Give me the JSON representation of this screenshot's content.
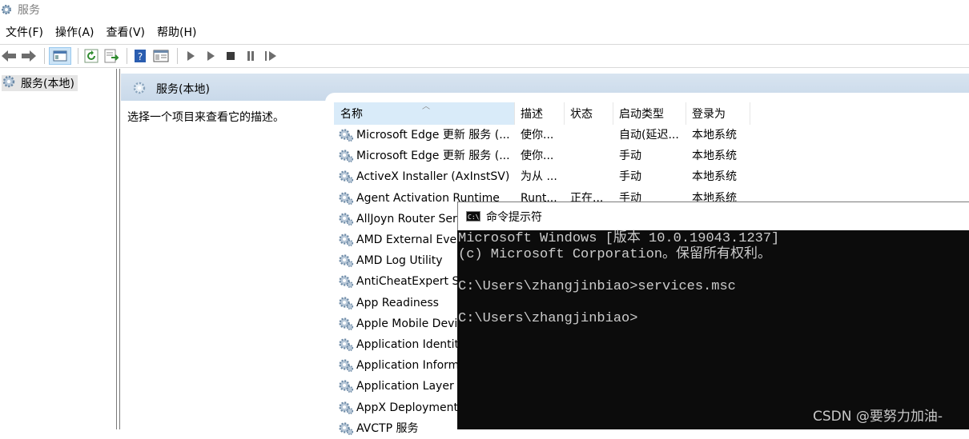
{
  "window": {
    "title": "服务"
  },
  "menu": [
    "文件(F)",
    "操作(A)",
    "查看(V)",
    "帮助(H)"
  ],
  "toolbar": [
    "back-icon",
    "forward-icon",
    "show-hide-console-tree-icon",
    "refresh-icon",
    "export-list-icon",
    "help-icon",
    "properties-icon",
    "start-service-icon",
    "start-service-alt-icon",
    "stop-service-icon",
    "pause-service-icon",
    "restart-service-icon"
  ],
  "tree": {
    "root_label": "服务(本地)"
  },
  "panel": {
    "header_title": "服务(本地)",
    "description_hint": "选择一个项目来查看它的描述。"
  },
  "table": {
    "columns": [
      "名称",
      "描述",
      "状态",
      "启动类型",
      "登录为"
    ],
    "rows": [
      [
        "Microsoft Edge 更新 服务 (...",
        "使你...",
        "",
        "自动(延迟...",
        "本地系统"
      ],
      [
        "Microsoft Edge 更新 服务 (...",
        "使你...",
        "",
        "手动",
        "本地系统"
      ],
      [
        "ActiveX Installer (AxInstSV)",
        "为从 ...",
        "",
        "手动",
        "本地系统"
      ],
      [
        "Agent Activation Runtime",
        "Runt...",
        "正在...",
        "手动",
        "本地系统"
      ],
      [
        "AllJoyn Router Ser",
        "",
        "",
        "",
        ""
      ],
      [
        "AMD External Even",
        "",
        "",
        "",
        ""
      ],
      [
        "AMD Log Utility",
        "",
        "",
        "",
        ""
      ],
      [
        "AntiCheatExpert Se",
        "",
        "",
        "",
        ""
      ],
      [
        "App Readiness",
        "",
        "",
        "",
        ""
      ],
      [
        "Apple Mobile Devi",
        "",
        "",
        "",
        ""
      ],
      [
        "Application Identity",
        "",
        "",
        "",
        ""
      ],
      [
        "Application Inform",
        "",
        "",
        "",
        ""
      ],
      [
        "Application Layer G",
        "",
        "",
        "",
        ""
      ],
      [
        "AppX Deployment",
        "",
        "",
        "",
        ""
      ],
      [
        "AVCTP 服务",
        "",
        "",
        "",
        ""
      ]
    ]
  },
  "cmd": {
    "title": "命令提示符",
    "icon_text": "C:\\",
    "lines": [
      "Microsoft Windows [版本 10.0.19043.1237]",
      "(c) Microsoft Corporation。保留所有权利。",
      "",
      "C:\\Users\\zhangjinbiao>services.msc",
      "",
      "C:\\Users\\zhangjinbiao>"
    ]
  },
  "watermark": "CSDN @要努力加油-"
}
